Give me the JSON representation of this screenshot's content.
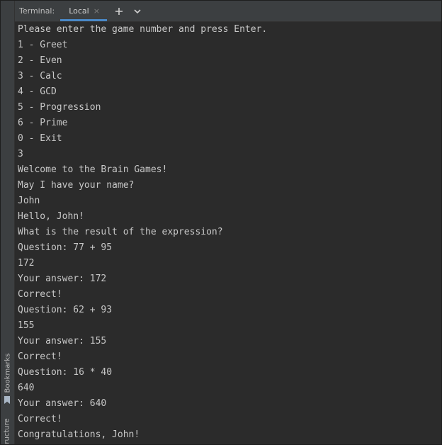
{
  "header": {
    "title": "Terminal:",
    "tab_label": "Local",
    "tab_close_glyph": "×",
    "new_tab_glyph": "+",
    "dropdown_glyph": "⌄"
  },
  "side_tabs": {
    "bookmarks": "Bookmarks",
    "structure": "ructure"
  },
  "terminal": {
    "lines": [
      "Please enter the game number and press Enter.",
      "1 - Greet",
      "2 - Even",
      "3 - Calc",
      "4 - GCD",
      "5 - Progression",
      "6 - Prime",
      "0 - Exit",
      "3",
      "Welcome to the Brain Games!",
      "May I have your name?",
      "John",
      "Hello, John!",
      "What is the result of the expression?",
      "Question: 77 + 95",
      "172",
      "Your answer: 172",
      "Correct!",
      "Question: 62 + 93",
      "155",
      "Your answer: 155",
      "Correct!",
      "Question: 16 * 40",
      "640",
      "Your answer: 640",
      "Correct!",
      "Congratulations, John!"
    ]
  },
  "colors": {
    "background": "#2b2b2b",
    "panel": "#3c3f41",
    "accent": "#4a88c7",
    "text": "#c8c8c8"
  }
}
